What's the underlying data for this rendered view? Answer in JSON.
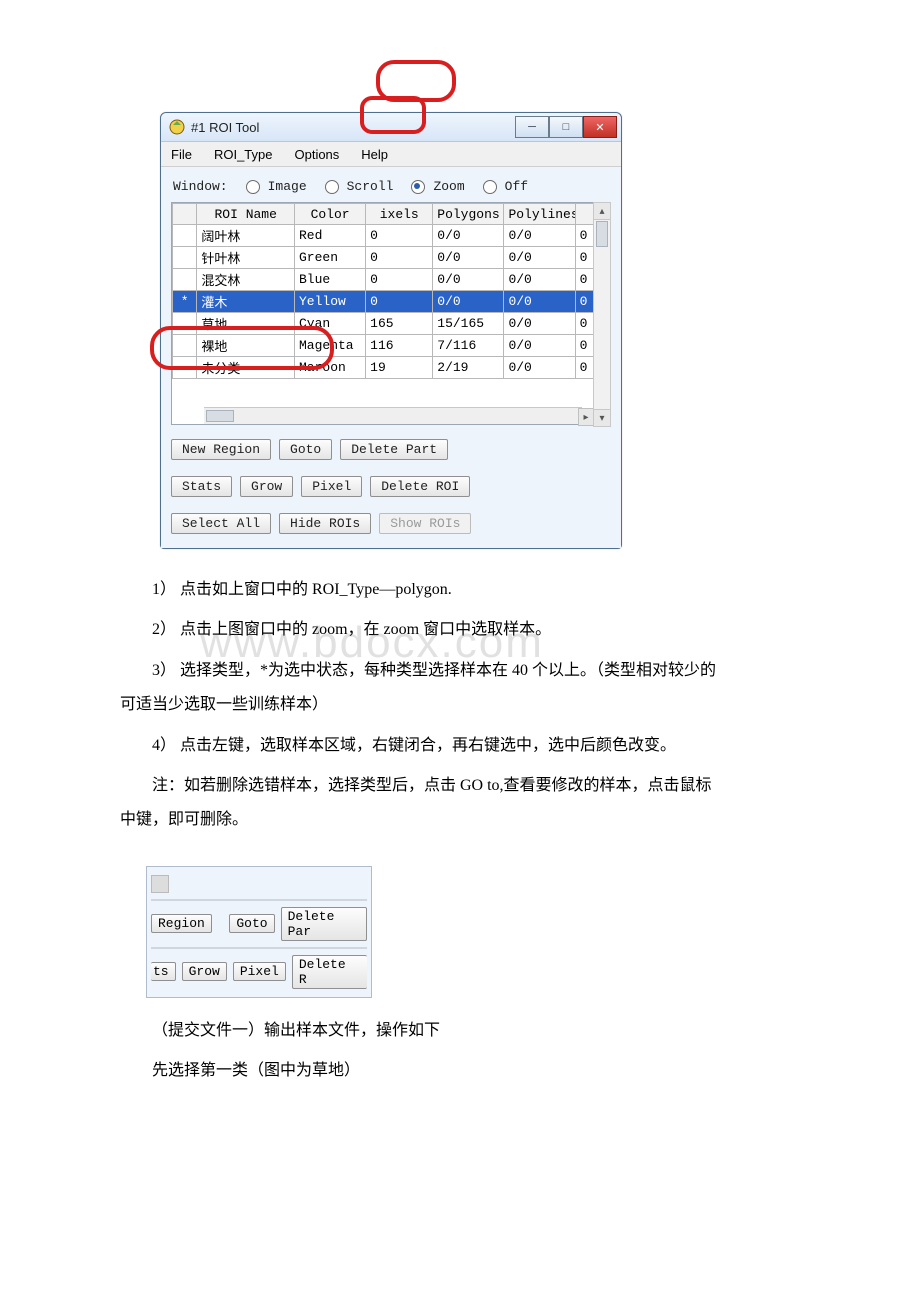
{
  "window": {
    "title": "#1 ROI Tool",
    "menu": {
      "file": "File",
      "roi_type": "ROI_Type",
      "options": "Options",
      "help": "Help"
    },
    "view_label": "Window:",
    "view_options": {
      "image": "Image",
      "scroll": "Scroll",
      "zoom": "Zoom",
      "off": "Off"
    },
    "view_selected": "zoom",
    "headers": {
      "name": "ROI Name",
      "color": "Color",
      "pixels": "ixels",
      "polygons": "Polygons",
      "polylines": "Polylines"
    },
    "rows": [
      {
        "mark": "",
        "name": "阔叶林",
        "color": "Red",
        "pixels": "0",
        "polygons": "0/0",
        "polylines": "0/0",
        "extra": "0"
      },
      {
        "mark": "",
        "name": "针叶林",
        "color": "Green",
        "pixels": "0",
        "polygons": "0/0",
        "polylines": "0/0",
        "extra": "0"
      },
      {
        "mark": "",
        "name": "混交林",
        "color": "Blue",
        "pixels": "0",
        "polygons": "0/0",
        "polylines": "0/0",
        "extra": "0"
      },
      {
        "mark": "*",
        "name": "灌木",
        "color": "Yellow",
        "pixels": "0",
        "polygons": "0/0",
        "polylines": "0/0",
        "extra": "0",
        "selected": true
      },
      {
        "mark": "",
        "name": "草地",
        "color": "Cyan",
        "pixels": "165",
        "polygons": "15/165",
        "polylines": "0/0",
        "extra": "0"
      },
      {
        "mark": "",
        "name": "裸地",
        "color": "Magenta",
        "pixels": "116",
        "polygons": "7/116",
        "polylines": "0/0",
        "extra": "0"
      },
      {
        "mark": "",
        "name": "未分类",
        "color": "Maroon",
        "pixels": "19",
        "polygons": "2/19",
        "polylines": "0/0",
        "extra": "0"
      }
    ],
    "buttons": {
      "new_region": "New Region",
      "goto": "Goto",
      "delete_part": "Delete Part",
      "stats": "Stats",
      "grow": "Grow",
      "pixel": "Pixel",
      "delete_roi": "Delete ROI",
      "select_all": "Select All",
      "hide_rois": "Hide ROIs",
      "show_rois": "Show ROIs"
    }
  },
  "mini": {
    "region": "Region",
    "goto": "Goto",
    "delete_par": "Delete Par",
    "ts": "ts",
    "grow": "Grow",
    "pixel": "Pixel",
    "delete_r": "Delete R"
  },
  "doc": {
    "p1": "1） 点击如上窗口中的 ROI_Type—polygon.",
    "p2": "2） 点击上图窗口中的 zoom，在 zoom 窗口中选取样本。",
    "p3a": "3） 选择类型，*为选中状态，每种类型选择样本在 40 个以上。（类型相对较少的",
    "p3b": "可适当少选取一些训练样本）",
    "p4": "4） 点击左键，选取样本区域，右键闭合，再右键选中，选中后颜色改变。",
    "p5a": "注：如若删除选错样本，选择类型后，点击 GO to,查看要修改的样本，点击鼠标",
    "p5b": "中键，即可删除。",
    "p6": "（提交文件一）输出样本文件，操作如下",
    "p7": "先选择第一类（图中为草地）"
  },
  "watermark": "www.bdocx.com"
}
